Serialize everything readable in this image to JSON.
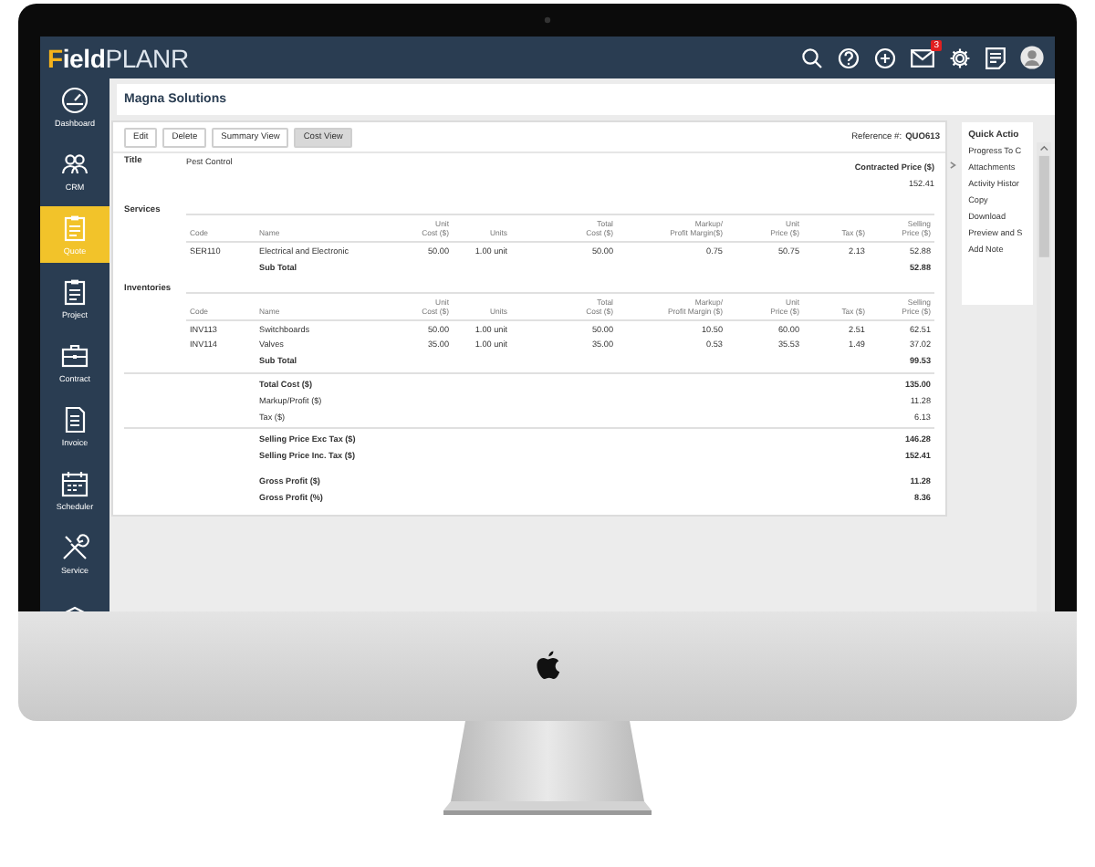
{
  "header": {
    "logo_parts": [
      "F",
      "ield",
      "PLANR"
    ],
    "mail_badge": "3"
  },
  "sidebar": {
    "items": [
      {
        "label": "Dashboard",
        "selected": false
      },
      {
        "label": "CRM",
        "selected": false
      },
      {
        "label": "Quote",
        "selected": true
      },
      {
        "label": "Project",
        "selected": false
      },
      {
        "label": "Contract",
        "selected": false
      },
      {
        "label": "Invoice",
        "selected": false
      },
      {
        "label": "Scheduler",
        "selected": false
      },
      {
        "label": "Service",
        "selected": false
      },
      {
        "selected": false
      }
    ]
  },
  "page_title": "Magna Solutions",
  "buttons": [
    {
      "label": "Edit",
      "selected": false
    },
    {
      "label": "Delete",
      "selected": false
    },
    {
      "label": "Summary View",
      "selected": false
    },
    {
      "label": "Cost View",
      "selected": true
    }
  ],
  "reference": {
    "label": "Reference #:",
    "value": "QUO613"
  },
  "title": {
    "label": "Title",
    "value": "Pest Control"
  },
  "contracted_price": {
    "label": "Contracted Price ($)",
    "value": "152.41"
  },
  "sections": [
    {
      "heading": "Services",
      "columns": [
        "Code",
        "Name",
        "Unit\nCost ($)",
        "Units",
        "Total\nCost ($)",
        "Markup/\nProfit Margin($)",
        "Unit\nPrice ($)",
        "Tax ($)",
        "Selling\nPrice ($)"
      ],
      "rows": [
        [
          "SER110",
          "Electrical and Electronic",
          "50.00",
          "1.00 unit",
          "50.00",
          "0.75",
          "50.75",
          "2.13",
          "52.88"
        ]
      ],
      "subtotal": {
        "label": "Sub Total",
        "value": "52.88"
      }
    },
    {
      "heading": "Inventories",
      "columns": [
        "Code",
        "Name",
        "Unit\nCost ($)",
        "Units",
        "Total\nCost ($)",
        "Markup/\nProfit Margin ($)",
        "Unit\nPrice ($)",
        "Tax ($)",
        "Selling\nPrice ($)"
      ],
      "rows": [
        [
          "INV113",
          "Switchboards",
          "50.00",
          "1.00 unit",
          "50.00",
          "10.50",
          "60.00",
          "2.51",
          "62.51"
        ],
        [
          "INV114",
          "Valves",
          "35.00",
          "1.00 unit",
          "35.00",
          "0.53",
          "35.53",
          "1.49",
          "37.02"
        ]
      ],
      "subtotal": {
        "label": "Sub Total",
        "value": "99.53"
      }
    }
  ],
  "totals": [
    [
      {
        "label": "Total Cost ($)",
        "value": "135.00",
        "bold": true
      },
      {
        "label": "Markup/Profit ($)",
        "value": "11.28",
        "bold": false
      },
      {
        "label": "Tax ($)",
        "value": "6.13",
        "bold": false
      }
    ],
    [
      {
        "label": "Selling Price Exc Tax ($)",
        "value": "146.28",
        "bold": true
      },
      {
        "label": "Selling Price Inc. Tax ($)",
        "value": "152.41",
        "bold": true
      }
    ],
    [
      {
        "label": "Gross Profit ($)",
        "value": "11.28",
        "bold": true
      },
      {
        "label": "Gross Profit (%)",
        "value": "8.36",
        "bold": true
      }
    ]
  ],
  "quick_actions": {
    "title": "Quick Actio",
    "items": [
      "Progress To C",
      "Attachments",
      "Activity Histor",
      "Copy",
      "Download",
      "Preview and S",
      "Add Note"
    ]
  }
}
